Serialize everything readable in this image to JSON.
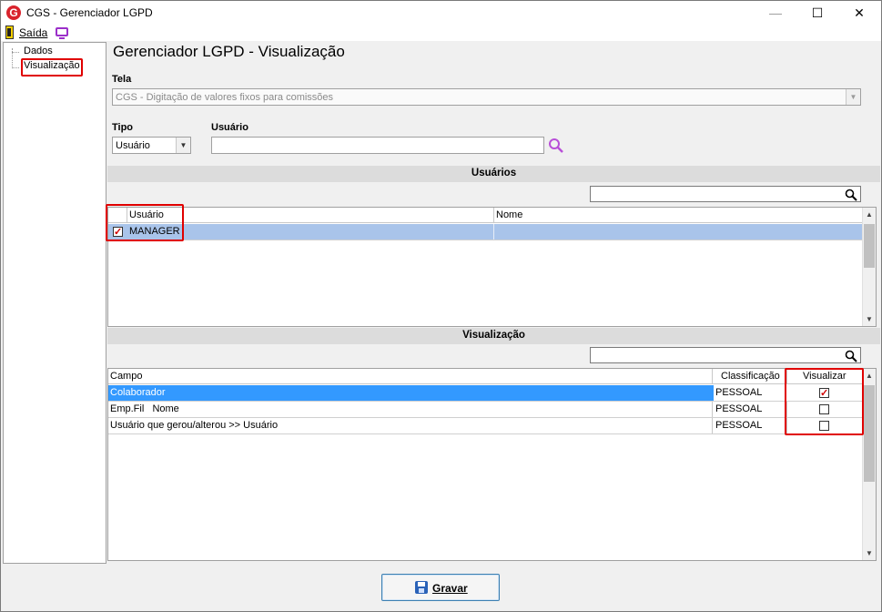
{
  "window": {
    "app_logo": "G",
    "title": "CGS - Gerenciador LGPD",
    "minimize_glyph": "—",
    "maximize_glyph": "☐",
    "close_glyph": "✕"
  },
  "menu": {
    "exit_label": "Saída",
    "exit_icon": "door-exit-icon",
    "screen_icon": "monitor-icon"
  },
  "tree": {
    "items": [
      {
        "label": "Dados"
      },
      {
        "label": "Visualização",
        "selected": true
      }
    ]
  },
  "page": {
    "title": "Gerenciador LGPD - Visualização"
  },
  "filters": {
    "tela_label": "Tela",
    "tela_value": "CGS - Digitação de valores fixos para comissões",
    "tipo_label": "Tipo",
    "tipo_value": "Usuário",
    "usuario_label": "Usuário",
    "usuario_value": "",
    "search_icon": "magnifier-icon"
  },
  "users_section": {
    "header": "Usuários",
    "search_value": "",
    "columns": [
      "Usuário",
      "Nome"
    ],
    "rows": [
      {
        "checked": true,
        "usuario": "MANAGER",
        "nome": ""
      }
    ]
  },
  "view_section": {
    "header": "Visualização",
    "search_value": "",
    "columns": [
      "Campo",
      "Classificação",
      "Visualizar"
    ],
    "rows": [
      {
        "campo": "Colaborador",
        "classificacao": "PESSOAL",
        "visualizar": true,
        "selected": true
      },
      {
        "campo": "Emp.Fil   Nome",
        "classificacao": "PESSOAL",
        "visualizar": false,
        "selected": false
      },
      {
        "campo": "Usuário que gerou/alterou >> Usuário",
        "classificacao": "PESSOAL",
        "visualizar": false,
        "selected": false
      }
    ]
  },
  "footer": {
    "save_label": "Gravar",
    "save_icon": "floppy-disk-icon"
  },
  "colors": {
    "selection_blue": "#3399ff",
    "row_highlight": "#a9c4ea",
    "highlight_red": "#e00000"
  }
}
